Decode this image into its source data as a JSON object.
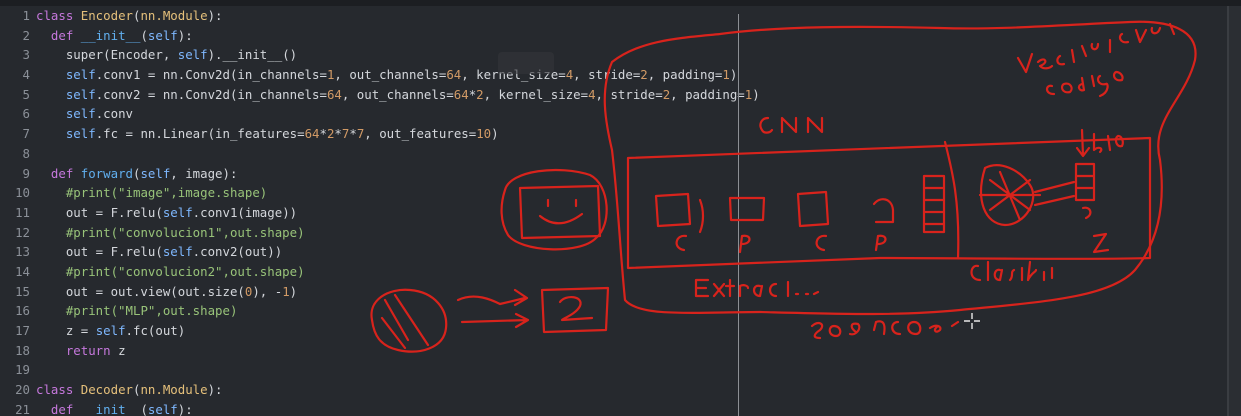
{
  "editor": {
    "lines": [
      {
        "n": "1",
        "tokens": [
          [
            "kw",
            "class "
          ],
          [
            "cls",
            "Encoder"
          ],
          [
            "pl",
            "("
          ],
          [
            "cls",
            "nn.Module"
          ],
          [
            "pl",
            "):"
          ]
        ]
      },
      {
        "n": "2",
        "tokens": [
          [
            "pl",
            "  "
          ],
          [
            "kw",
            "def "
          ],
          [
            "fn",
            "__init__"
          ],
          [
            "pl",
            "("
          ],
          [
            "self",
            "self"
          ],
          [
            "pl",
            "):"
          ]
        ]
      },
      {
        "n": "3",
        "tokens": [
          [
            "pl",
            "    super(Encoder, "
          ],
          [
            "self",
            "self"
          ],
          [
            "pl",
            ").__init__()"
          ]
        ]
      },
      {
        "n": "4",
        "tokens": [
          [
            "pl",
            "    "
          ],
          [
            "self",
            "self"
          ],
          [
            "pl",
            ".conv1 = nn.Conv2d(in_channels="
          ],
          [
            "num",
            "1"
          ],
          [
            "pl",
            ", out_channels="
          ],
          [
            "num",
            "64"
          ],
          [
            "pl",
            ", kernel_size="
          ],
          [
            "num",
            "4"
          ],
          [
            "pl",
            ", stride="
          ],
          [
            "num",
            "2"
          ],
          [
            "pl",
            ", padding="
          ],
          [
            "num",
            "1"
          ],
          [
            "pl",
            ")"
          ]
        ]
      },
      {
        "n": "5",
        "tokens": [
          [
            "pl",
            "    "
          ],
          [
            "self",
            "self"
          ],
          [
            "pl",
            ".conv2 = nn.Conv2d(in_channels="
          ],
          [
            "num",
            "64"
          ],
          [
            "pl",
            ", out_channels="
          ],
          [
            "num",
            "64"
          ],
          [
            "pl",
            "*"
          ],
          [
            "num",
            "2"
          ],
          [
            "pl",
            ", kernel_size="
          ],
          [
            "num",
            "4"
          ],
          [
            "pl",
            ", stride="
          ],
          [
            "num",
            "2"
          ],
          [
            "pl",
            ", padding="
          ],
          [
            "num",
            "1"
          ],
          [
            "pl",
            ")"
          ]
        ]
      },
      {
        "n": "6",
        "tokens": [
          [
            "pl",
            "    "
          ],
          [
            "self",
            "self"
          ],
          [
            "pl",
            ".conv"
          ]
        ]
      },
      {
        "n": "7",
        "tokens": [
          [
            "pl",
            "    "
          ],
          [
            "self",
            "self"
          ],
          [
            "pl",
            ".fc = nn.Linear(in_features="
          ],
          [
            "num",
            "64"
          ],
          [
            "pl",
            "*"
          ],
          [
            "num",
            "2"
          ],
          [
            "pl",
            "*"
          ],
          [
            "num",
            "7"
          ],
          [
            "pl",
            "*"
          ],
          [
            "num",
            "7"
          ],
          [
            "pl",
            ", out_features="
          ],
          [
            "num",
            "10"
          ],
          [
            "pl",
            ")"
          ]
        ]
      },
      {
        "n": "8",
        "tokens": []
      },
      {
        "n": "9",
        "tokens": [
          [
            "pl",
            "  "
          ],
          [
            "kw",
            "def "
          ],
          [
            "fn",
            "forward"
          ],
          [
            "pl",
            "("
          ],
          [
            "self",
            "self"
          ],
          [
            "pl",
            ", image):"
          ]
        ]
      },
      {
        "n": "10",
        "tokens": [
          [
            "pl",
            "    "
          ],
          [
            "cm",
            "#print(\"image\",image.shape)"
          ]
        ]
      },
      {
        "n": "11",
        "tokens": [
          [
            "pl",
            "    out = F.relu("
          ],
          [
            "self",
            "self"
          ],
          [
            "pl",
            ".conv1(image))"
          ]
        ]
      },
      {
        "n": "12",
        "tokens": [
          [
            "pl",
            "    "
          ],
          [
            "cm",
            "#print(\"convolucion1\",out.shape)"
          ]
        ]
      },
      {
        "n": "13",
        "tokens": [
          [
            "pl",
            "    out = F.relu("
          ],
          [
            "self",
            "self"
          ],
          [
            "pl",
            ".conv2(out))"
          ]
        ]
      },
      {
        "n": "14",
        "tokens": [
          [
            "pl",
            "    "
          ],
          [
            "cm",
            "#print(\"convolucion2\",out.shape)"
          ]
        ]
      },
      {
        "n": "15",
        "tokens": [
          [
            "pl",
            "    out = out.view(out.size("
          ],
          [
            "num",
            "0"
          ],
          [
            "pl",
            "), -"
          ],
          [
            "num",
            "1"
          ],
          [
            "pl",
            ")"
          ]
        ]
      },
      {
        "n": "16",
        "tokens": [
          [
            "pl",
            "    "
          ],
          [
            "cm",
            "#print(\"MLP\",out.shape)"
          ]
        ]
      },
      {
        "n": "17",
        "tokens": [
          [
            "pl",
            "    z = "
          ],
          [
            "self",
            "self"
          ],
          [
            "pl",
            ".fc(out)"
          ]
        ]
      },
      {
        "n": "18",
        "tokens": [
          [
            "pl",
            "    "
          ],
          [
            "kw",
            "return "
          ],
          [
            "pl",
            "z"
          ]
        ]
      },
      {
        "n": "19",
        "tokens": []
      },
      {
        "n": "20",
        "tokens": [
          [
            "kw",
            "class "
          ],
          [
            "cls",
            "Decoder"
          ],
          [
            "pl",
            "("
          ],
          [
            "cls",
            "nn.Module"
          ],
          [
            "pl",
            "):"
          ]
        ]
      },
      {
        "n": "21",
        "tokens": [
          [
            "pl",
            "  "
          ],
          [
            "kw",
            "def "
          ],
          [
            "fn",
            "__init__"
          ],
          [
            "pl",
            "("
          ],
          [
            "self",
            "self"
          ],
          [
            "pl",
            "):"
          ]
        ]
      }
    ]
  },
  "annotations": {
    "ink_color": "#d8231c",
    "labels": {
      "cnn": "CNN",
      "vector": "vector latente",
      "codigo": "código",
      "size": "b10",
      "c1": "C",
      "p1": "P",
      "c2": "C",
      "p2": "P",
      "z": "Z",
      "extractor": "Extract...",
      "clasif": "clasifi...",
      "encoder": "encoder",
      "digit": "2"
    }
  }
}
